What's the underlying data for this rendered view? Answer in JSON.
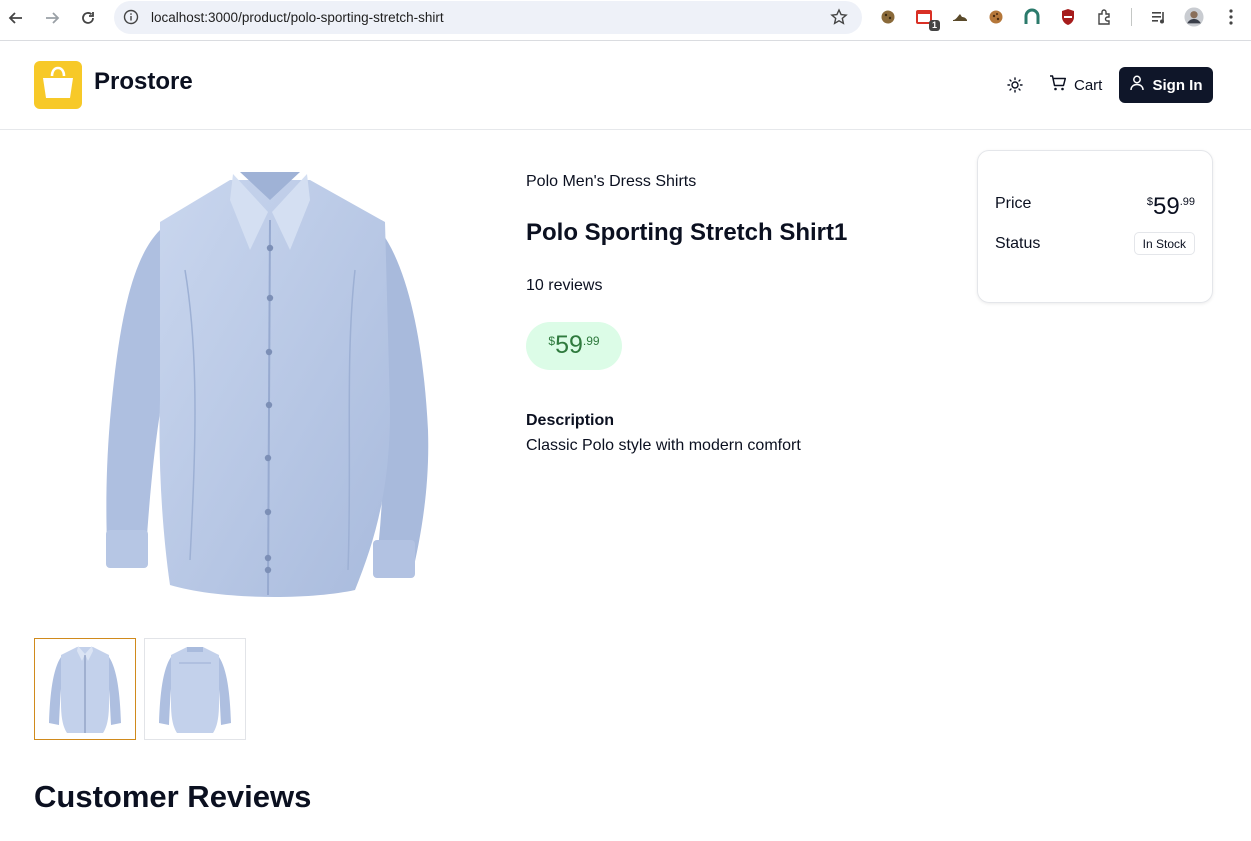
{
  "browser": {
    "url": "localhost:3000/product/polo-sporting-stretch-shirt",
    "extension_badge": "1"
  },
  "header": {
    "brand": "Prostore",
    "cart_label": "Cart",
    "signin_label": "Sign In"
  },
  "product": {
    "brand_category": "Polo Men's Dress Shirts",
    "name": "Polo Sporting Stretch Shirt1",
    "reviews": "10 reviews",
    "price": {
      "currency": "$",
      "whole": "59",
      "cents": ".99"
    },
    "description_title": "Description",
    "description": "Classic Polo style with modern comfort",
    "thumbnails": [
      "front",
      "back"
    ],
    "selected_thumbnail": 0
  },
  "card": {
    "price_label": "Price",
    "price": {
      "currency": "$",
      "whole": "59",
      "cents": ".99"
    },
    "status_label": "Status",
    "status": "In Stock"
  },
  "reviews_section": {
    "title": "Customer Reviews"
  },
  "colors": {
    "accent": "#0f1629",
    "logo": "#f7c928",
    "price_bg": "#dcfce7",
    "price_text": "#2f7a3e",
    "active_thumb_border": "#d08a1c",
    "shirt": "#b8c8e6"
  },
  "icons": [
    "back-arrow-icon",
    "forward-arrow-icon",
    "reload-icon",
    "info-icon",
    "star-icon",
    "extensions-icon",
    "media-icon",
    "profile-avatar",
    "menu-icon",
    "shopping-bag-icon",
    "sun-icon",
    "cart-icon",
    "user-icon"
  ]
}
